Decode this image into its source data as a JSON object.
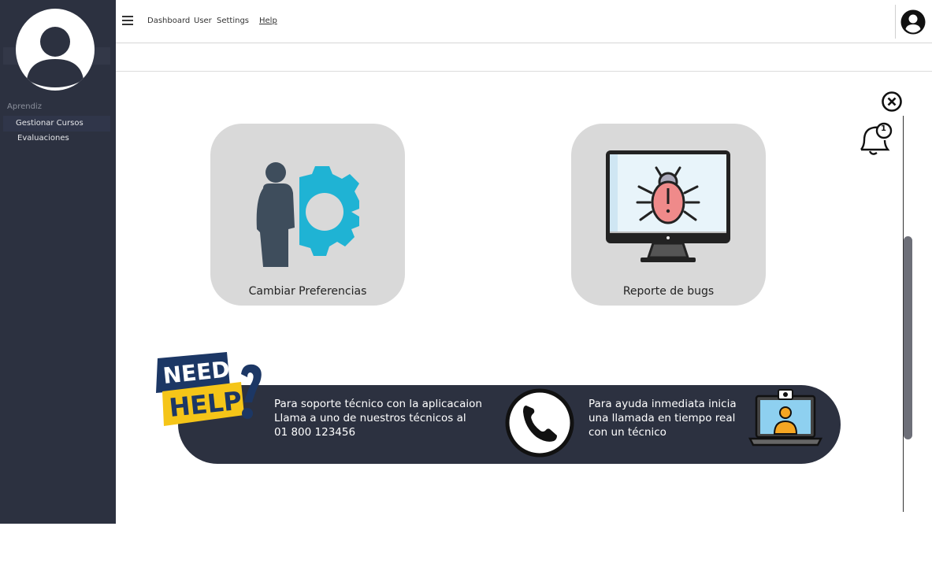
{
  "sidebar": {
    "section_label": "Aprendiz",
    "items": [
      {
        "label": "Gestionar Cursos"
      },
      {
        "label": "Evaluaciones"
      }
    ]
  },
  "topbar": {
    "nav": [
      {
        "label": "Dashboard"
      },
      {
        "label": "User"
      },
      {
        "label": "Settings"
      },
      {
        "label": "Help"
      }
    ]
  },
  "cards": [
    {
      "label": "Cambiar Preferencias",
      "icon": "person-gear-icon"
    },
    {
      "label": "Reporte de bugs",
      "icon": "monitor-bug-icon"
    }
  ],
  "notifications": {
    "count": "1"
  },
  "help": {
    "badge_line1": "NEED",
    "badge_line2": "HELP",
    "left_text": [
      "Para soporte técnico con la aplicacaion",
      "Llama a uno de nuestros técnicos al",
      "01 800 123456"
    ],
    "right_text": [
      "Para ayuda inmediata inicia",
      "una llamada en tiempo real",
      "con un técnico"
    ]
  },
  "colors": {
    "sidebar": "#2c3140",
    "card": "#d9d9d9",
    "gear": "#1fb3d4",
    "person": "#3e4d5c",
    "badge_yellow": "#f5c518",
    "badge_navy": "#1c3765"
  }
}
